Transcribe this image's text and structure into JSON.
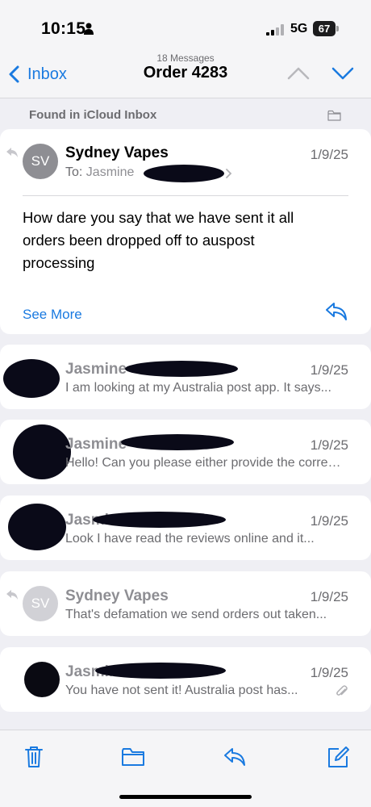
{
  "status": {
    "time": "10:15",
    "network": "5G",
    "battery": "67"
  },
  "nav": {
    "back_label": "Inbox",
    "subtitle": "18 Messages",
    "title": "Order 4283"
  },
  "found_in": "Found in iCloud Inbox",
  "expanded_message": {
    "avatar": "SV",
    "sender": "Sydney Vapes",
    "date": "1/9/25",
    "to_label": "To:",
    "recipient": "Jasmine",
    "body": "How dare you say that we have sent it all orders been dropped off to auspost processing",
    "see_more": "See More"
  },
  "messages": [
    {
      "sender": "Jasmine",
      "date": "1/9/25",
      "preview": "I am looking at my Australia post app. It says..."
    },
    {
      "sender": "Jasmine",
      "date": "1/9/25",
      "preview": "Hello! Can you please either provide the correct..."
    },
    {
      "sender": "Jasmine",
      "date": "1/9/25",
      "preview": "Look I have read the reviews online and it..."
    },
    {
      "sender": "Sydney Vapes",
      "avatar": "SV",
      "date": "1/9/25",
      "preview": "That's defamation we send orders out taken..."
    },
    {
      "sender": "Jasmine",
      "date": "1/9/25",
      "preview": "You have not sent it! Australia post has..."
    }
  ],
  "icons": {
    "toolbar": [
      "trash-icon",
      "folder-icon",
      "reply-icon",
      "compose-icon"
    ],
    "accent": "#1a7ae0"
  }
}
